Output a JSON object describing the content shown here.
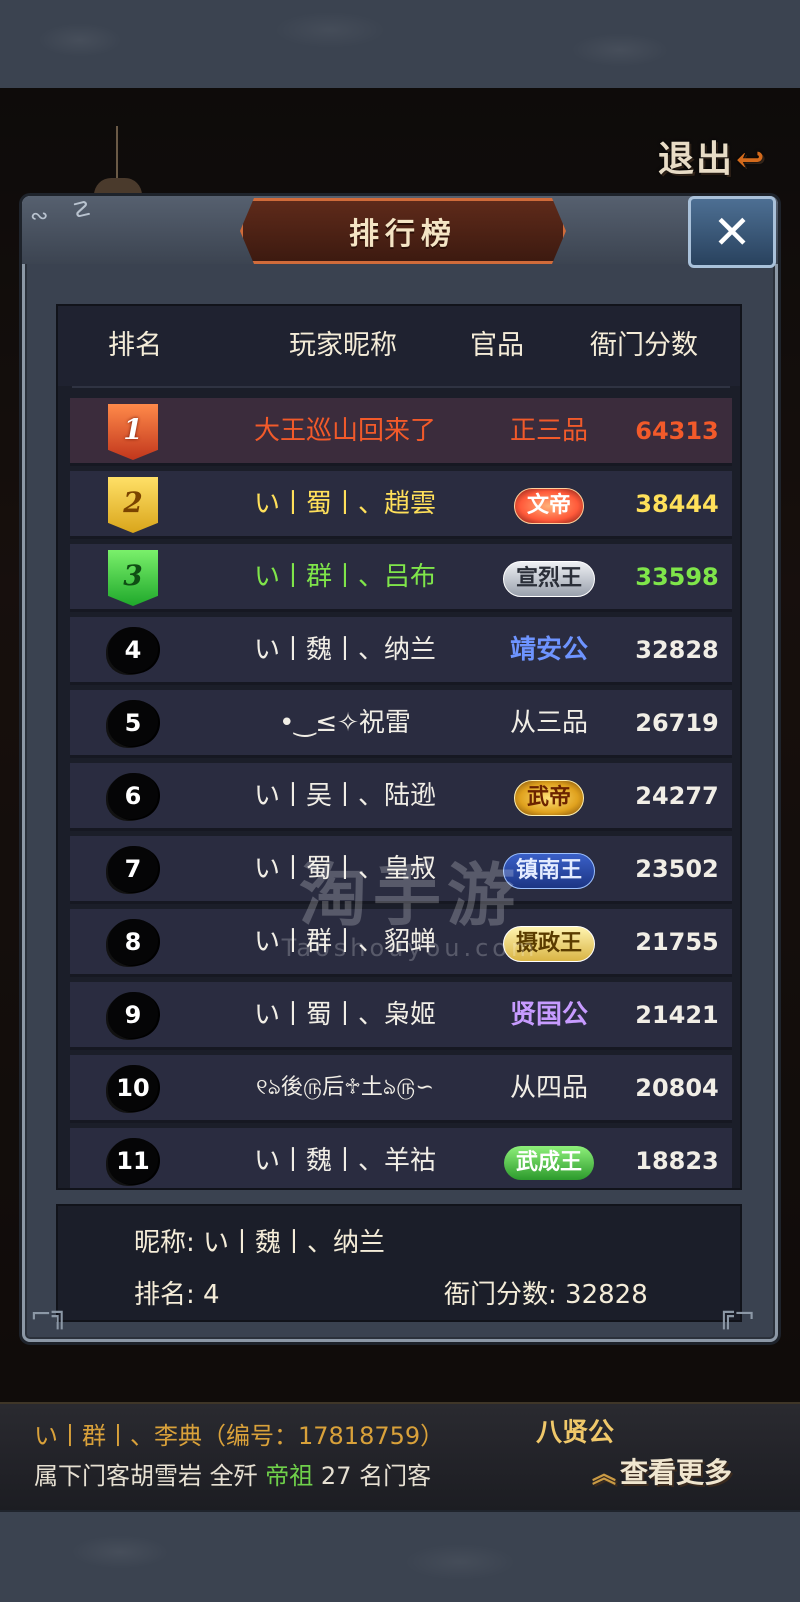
{
  "exit": {
    "label": "退出",
    "icon": "arrow-back-icon"
  },
  "panel": {
    "title": "排行榜",
    "close_icon": "close-icon"
  },
  "table": {
    "headers": [
      "排名",
      "玩家昵称",
      "官品",
      "衙门分数"
    ],
    "rows": [
      {
        "rank": "1",
        "name": "大王巡山回来了",
        "title": "正三品",
        "score": "64313"
      },
      {
        "rank": "2",
        "name": "い丨蜀丨、趙雲",
        "title": "文帝",
        "score": "38444"
      },
      {
        "rank": "3",
        "name": "い丨群丨、吕布",
        "title": "宣烈王",
        "score": "33598"
      },
      {
        "rank": "4",
        "name": "い丨魏丨、纳兰",
        "title": "靖安公",
        "score": "32828"
      },
      {
        "rank": "5",
        "name": "•‿≤✧祝雷",
        "title": "从三品",
        "score": "26719"
      },
      {
        "rank": "6",
        "name": "い丨吴丨、陆逊",
        "title": "武帝",
        "score": "24277"
      },
      {
        "rank": "7",
        "name": "い丨蜀丨、皇叔",
        "title": "镇南王",
        "score": "23502"
      },
      {
        "rank": "8",
        "name": "い丨群丨、貂蝉",
        "title": "摄政王",
        "score": "21755"
      },
      {
        "rank": "9",
        "name": "い丨蜀丨、枭姬",
        "title": "贤国公",
        "score": "21421"
      },
      {
        "rank": "10",
        "name": "୧ঌ後௫后♱土ঌ௫∽",
        "title": "从四品",
        "score": "20804"
      },
      {
        "rank": "11",
        "name": "い丨魏丨、羊祜",
        "title": "武成王",
        "score": "18823"
      }
    ]
  },
  "watermark": {
    "main": "淘手游",
    "sub": "Taoshouyou.com"
  },
  "my_info": {
    "nickname_label": "昵称:",
    "nickname": "い丨魏丨、纳兰",
    "rank_label": "排名:",
    "rank": "4",
    "score_label": "衙门分数:",
    "score": "32828"
  },
  "status_bar": {
    "line1": "い丨群丨、李典（编号：17818759）",
    "line2_prefix": "属下门客胡雪岩 全歼",
    "line2_highlight": "帝祖",
    "line2_suffix": "27 名门客",
    "rank_title": "八贤公",
    "more_label": "查看更多"
  },
  "colors": {
    "rank1": "#f25a2a",
    "rank2": "#ffe05a",
    "rank3": "#7fe54a",
    "accent_title_border": "#d06b3a",
    "close_button": "#3a5a80"
  }
}
